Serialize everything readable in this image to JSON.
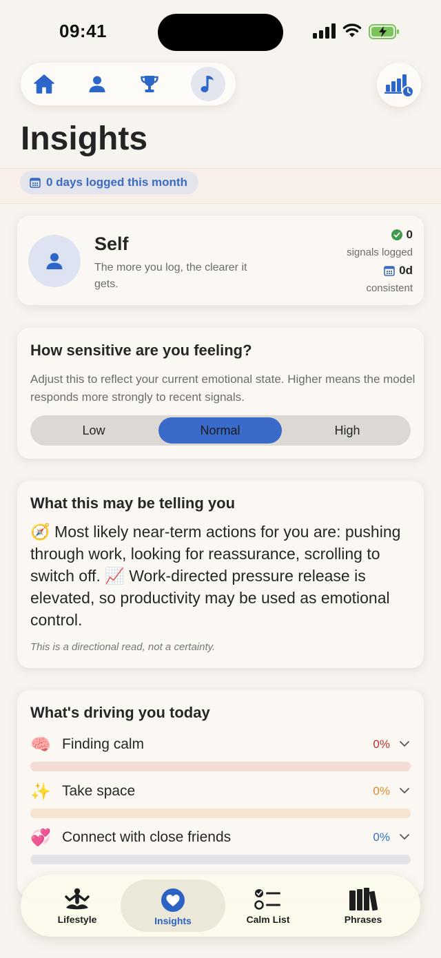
{
  "status": {
    "time": "09:41"
  },
  "header": {
    "title": "Insights",
    "days_logged": "0 days logged this month"
  },
  "self_card": {
    "name": "Self",
    "subtitle": "The more you log, the clearer it gets.",
    "signals_value": "0",
    "signals_label": "signals logged",
    "consistent_value": "0d",
    "consistent_label": "consistent"
  },
  "sensitivity": {
    "title": "How sensitive are you feeling?",
    "description": "Adjust this to reflect your current emotional state. Higher means the model responds more strongly to recent signals.",
    "options": [
      "Low",
      "Normal",
      "High"
    ],
    "selected": "Normal"
  },
  "telling": {
    "title": "What this may be telling you",
    "part1_emoji": "🧭",
    "part1": " Most likely near-term actions for you are: pushing through work, looking for reassurance, scrolling to switch off. ",
    "part2_emoji": "📈",
    "part2": " Work-directed pressure release is elevated, so productivity may be used as emotional control.",
    "note": "This is a directional read, not a certainty."
  },
  "drivers": {
    "title": "What's driving you today",
    "items": [
      {
        "emoji": "🧠",
        "label": "Finding calm",
        "percent": "0%",
        "color": "#b8322a",
        "bar": "#f4dcd6",
        "value": 0
      },
      {
        "emoji": "✨",
        "label": "Take space",
        "percent": "0%",
        "color": "#e0892a",
        "bar": "#f7e4d3",
        "value": 0
      },
      {
        "emoji": "💞",
        "label": "Connect with close friends",
        "percent": "0%",
        "color": "#3470c2",
        "bar": "#e2e4e8",
        "value": 0
      }
    ]
  },
  "tabs": [
    {
      "label": "Lifestyle",
      "icon": "meditation-icon"
    },
    {
      "label": "Insights",
      "icon": "heart-icon"
    },
    {
      "label": "Calm List",
      "icon": "checklist-icon"
    },
    {
      "label": "Phrases",
      "icon": "books-icon"
    }
  ],
  "active_tab": "Insights",
  "colors": {
    "accent": "#3a6bca",
    "background": "#f7f3ee",
    "card": "#fbf8f4"
  }
}
